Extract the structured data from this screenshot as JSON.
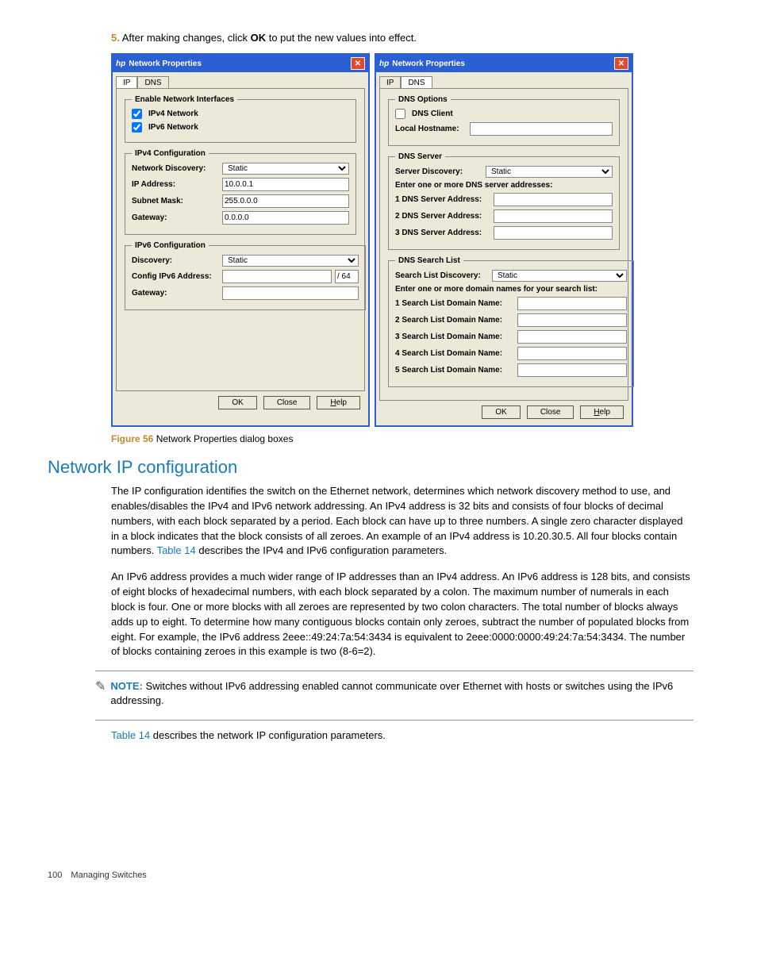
{
  "step": {
    "number": "5.",
    "text_before": "After making changes, click ",
    "bold": "OK",
    "text_after": " to put the new values into effect."
  },
  "win1": {
    "title": "Network Properties",
    "tabs": {
      "ip": "IP",
      "dns": "DNS"
    },
    "grp_enable": {
      "legend": "Enable Network Interfaces",
      "ipv4_label": "IPv4 Network",
      "ipv6_label": "IPv6 Network",
      "ipv4_checked": true,
      "ipv6_checked": true
    },
    "grp_ipv4": {
      "legend": "IPv4 Configuration",
      "discovery_label": "Network Discovery:",
      "discovery_value": "Static",
      "ip_label": "IP Address:",
      "ip_value": "10.0.0.1",
      "mask_label": "Subnet Mask:",
      "mask_value": "255.0.0.0",
      "gw_label": "Gateway:",
      "gw_value": "0.0.0.0"
    },
    "grp_ipv6": {
      "legend": "IPv6 Configuration",
      "discovery_label": "Discovery:",
      "discovery_value": "Static",
      "addr_label": "Config IPv6 Address:",
      "addr_prefix": "/ 64",
      "gw_label": "Gateway:"
    },
    "buttons": {
      "ok": "OK",
      "close": "Close",
      "help_u": "H",
      "help_rest": "elp"
    }
  },
  "win2": {
    "title": "Network Properties",
    "tabs": {
      "ip": "IP",
      "dns": "DNS"
    },
    "grp_options": {
      "legend": "DNS Options",
      "client_label": "DNS Client",
      "client_checked": false,
      "host_label": "Local Hostname:"
    },
    "grp_server": {
      "legend": "DNS Server",
      "discovery_label": "Server Discovery:",
      "discovery_value": "Static",
      "enter_label": "Enter one or more DNS server addresses:",
      "s1": "1 DNS Server Address:",
      "s2": "2 DNS Server Address:",
      "s3": "3 DNS Server Address:"
    },
    "grp_search": {
      "legend": "DNS Search List",
      "discovery_label": "Search List Discovery:",
      "discovery_value": "Static",
      "enter_label": "Enter one or more domain names for your search list:",
      "d1": "1 Search List Domain Name:",
      "d2": "2 Search List Domain Name:",
      "d3": "3 Search List Domain Name:",
      "d4": "4 Search List Domain Name:",
      "d5": "5 Search List Domain Name:"
    },
    "buttons": {
      "ok": "OK",
      "close": "Close",
      "help_u": "H",
      "help_rest": "elp"
    }
  },
  "figure_caption": {
    "label": "Figure 56",
    "text": " Network Properties dialog boxes"
  },
  "section_title": "Network IP configuration",
  "para1_a": "The IP configuration identifies the switch on the Ethernet network, determines which network discovery method to use, and enables/disables the IPv4 and IPv6 network addressing. An IPv4 address is 32 bits and consists of four blocks of decimal numbers, with each block separated by a period. Each block can have up to three numbers. A single zero character displayed in a block indicates that the block consists of all zeroes. An example of an IPv4 address is 10.20.30.5. All four blocks contain numbers. ",
  "para1_link": "Table 14",
  "para1_b": " describes the IPv4 and IPv6 configuration parameters.",
  "para2": "An IPv6 address provides a much wider range of IP addresses than an IPv4 address. An IPv6 address is 128 bits, and consists of eight blocks of hexadecimal numbers, with each block separated by a colon. The maximum number of numerals in each block is four. One or more blocks with all zeroes are represented by two colon characters. The total number of blocks always adds up to eight. To determine how many contiguous blocks contain only zeroes, subtract the number of populated blocks from eight. For example, the IPv6 address 2eee::49:24:7a:54:3434 is equivalent to 2eee:0000:0000:49:24:7a:54:3434. The number of blocks containing zeroes in this example is two (8-6=2).",
  "note": {
    "label": "NOTE:",
    "text": "Switches without IPv6 addressing enabled cannot communicate over Ethernet with hosts or switches using the IPv6 addressing."
  },
  "para3_link": "Table 14",
  "para3_rest": " describes the network IP configuration parameters.",
  "footer": {
    "page": "100",
    "chapter": "Managing Switches"
  }
}
